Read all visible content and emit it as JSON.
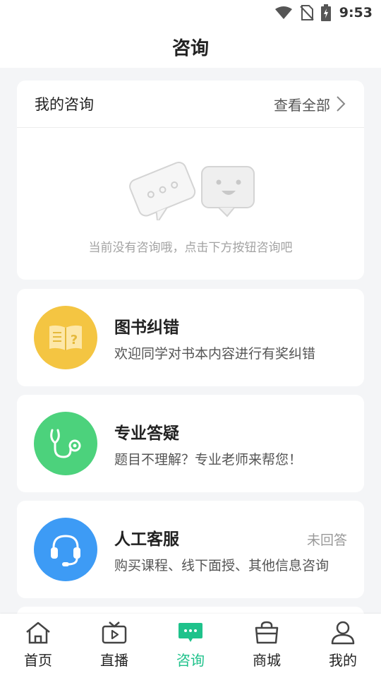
{
  "status_bar": {
    "time": "9:53"
  },
  "header": {
    "title": "咨询"
  },
  "my_consult": {
    "title": "我的咨询",
    "view_all": "查看全部",
    "empty_text": "当前没有咨询哦，点击下方按钮咨询吧"
  },
  "features": [
    {
      "title": "图书纠错",
      "desc": "欢迎同学对书本内容进行有奖纠错",
      "color": "#f4c542",
      "icon": "book-icon"
    },
    {
      "title": "专业答疑",
      "desc": "题目不理解？专业老师来帮您！",
      "color": "#4cd27c",
      "icon": "stethoscope-icon"
    },
    {
      "title": "人工客服",
      "desc": "购买课程、线下面授、其他信息咨询",
      "badge": "未回答",
      "color": "#3d9bf5",
      "icon": "headset-icon"
    }
  ],
  "tabs": [
    {
      "label": "首页",
      "icon": "home-icon"
    },
    {
      "label": "直播",
      "icon": "tv-icon"
    },
    {
      "label": "咨询",
      "icon": "chat-icon",
      "active": true
    },
    {
      "label": "商城",
      "icon": "shopping-bag-icon"
    },
    {
      "label": "我的",
      "icon": "person-icon"
    }
  ],
  "colors": {
    "accent": "#1fc28b",
    "background": "#f4f5f7"
  }
}
